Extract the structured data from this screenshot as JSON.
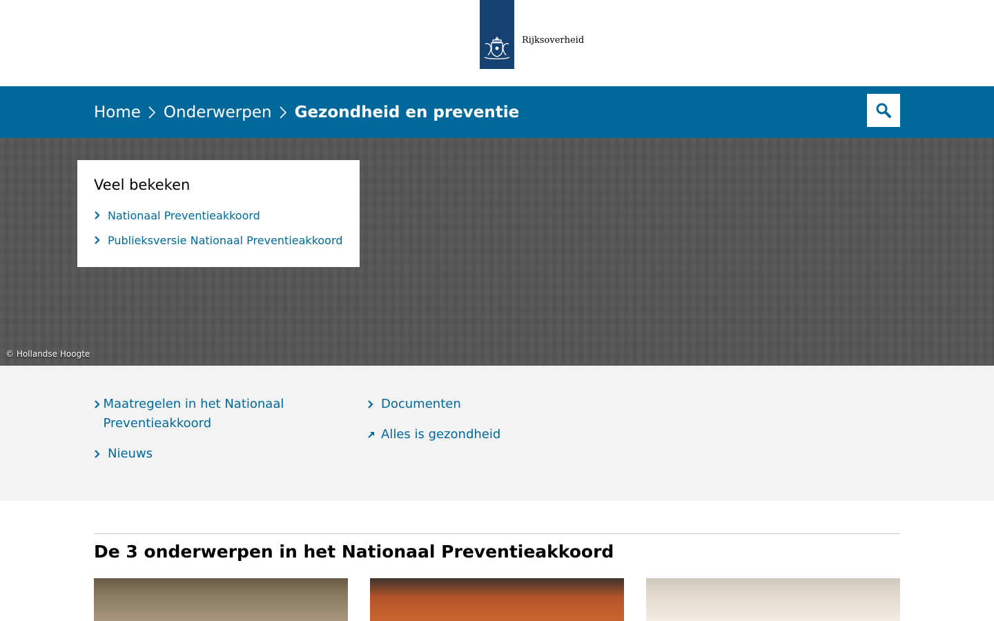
{
  "brand": {
    "name": "Rijksoverheid",
    "color": "#154273"
  },
  "breadcrumb": {
    "items": [
      {
        "label": "Home"
      },
      {
        "label": "Onderwerpen"
      },
      {
        "label": "Gezondheid en preventie"
      }
    ]
  },
  "search": {
    "icon": "search-icon"
  },
  "hero": {
    "credit": "© Hollandse Hoogte",
    "popular": {
      "title": "Veel bekeken",
      "items": [
        {
          "label": "Nationaal Preventieakkoord"
        },
        {
          "label": "Publieksversie Nationaal Preventieakkoord"
        }
      ]
    }
  },
  "links": {
    "items": [
      {
        "label": "Maatregelen in het Nationaal Preventieakkoord",
        "icon": "chevron-right-icon"
      },
      {
        "label": "Nieuws",
        "icon": "chevron-right-icon"
      },
      {
        "label": "Documenten",
        "icon": "chevron-right-icon"
      },
      {
        "label": "Alles is gezondheid",
        "icon": "external-arrow-icon"
      }
    ]
  },
  "section": {
    "title": "De 3 onderwerpen in het Nationaal Preventieakkoord"
  },
  "colors": {
    "navbar": "#01689b",
    "link": "#01689b",
    "links_bg": "#f3f3f3"
  }
}
